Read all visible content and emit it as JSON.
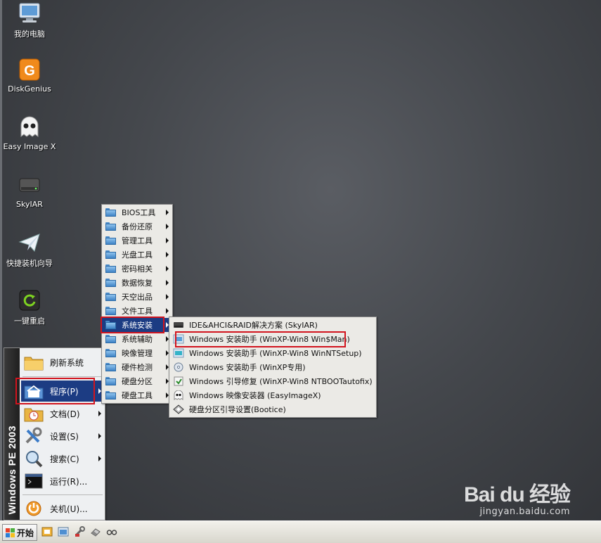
{
  "desktop": {
    "icons": [
      {
        "label": "我的电脑",
        "icon": "computer-icon"
      },
      {
        "label": "DiskGenius",
        "icon": "diskgenius-icon"
      },
      {
        "label": "Easy Image X",
        "icon": "ghost-icon"
      },
      {
        "label": "SkyIAR",
        "icon": "drive-icon"
      },
      {
        "label": "快捷装机向导",
        "icon": "paper-plane-icon"
      },
      {
        "label": "一键重启",
        "icon": "restart-icon"
      }
    ]
  },
  "start_menu": {
    "band_text": "Windows PE 2003",
    "items": [
      {
        "label": "刷新系统",
        "icon": "folder-icon",
        "has_submenu": false
      },
      {
        "label": "程序(P)",
        "icon": "programs-icon",
        "has_submenu": true,
        "active": true
      },
      {
        "label": "文档(D)",
        "icon": "documents-icon",
        "has_submenu": true
      },
      {
        "label": "设置(S)",
        "icon": "settings-icon",
        "has_submenu": true
      },
      {
        "label": "搜索(C)",
        "icon": "search-icon",
        "has_submenu": true
      },
      {
        "label": "运行(R)...",
        "icon": "run-icon",
        "has_submenu": false
      },
      {
        "label": "关机(U)...",
        "icon": "shutdown-icon",
        "has_submenu": false
      }
    ]
  },
  "programs_menu": {
    "items": [
      {
        "label": "BIOS工具"
      },
      {
        "label": "备份还原"
      },
      {
        "label": "管理工具"
      },
      {
        "label": "光盘工具"
      },
      {
        "label": "密码相关"
      },
      {
        "label": "数据恢复"
      },
      {
        "label": "天空出品"
      },
      {
        "label": "文件工具"
      },
      {
        "label": "系统安装",
        "active": true
      },
      {
        "label": "系统辅助"
      },
      {
        "label": "映像管理"
      },
      {
        "label": "硬件检测"
      },
      {
        "label": "硬盘分区"
      },
      {
        "label": "硬盘工具"
      }
    ]
  },
  "system_install_menu": {
    "items": [
      {
        "label": "IDE&AHCI&RAID解决方案 (SkyIAR)",
        "icon": "drive-icon"
      },
      {
        "label": "Windows 安装助手 (WinXP-Win8 Win$Man)",
        "icon": "installer-icon",
        "highlighted": true
      },
      {
        "label": "Windows 安装助手 (WinXP-Win8 WinNTSetup)",
        "icon": "installer-icon"
      },
      {
        "label": "Windows 安装助手 (WinXP专用)",
        "icon": "cd-installer-icon"
      },
      {
        "label": "Windows 引导修复 (WinXP-Win8 NTBOOTautofix)",
        "icon": "boot-fix-icon"
      },
      {
        "label": "Windows 映像安装器 (EasyImageX)",
        "icon": "ghost-icon"
      },
      {
        "label": "硬盘分区引导设置(Bootice)",
        "icon": "bootice-icon"
      }
    ]
  },
  "taskbar": {
    "start_label": "开始",
    "quick_launch": [
      "folder-icon",
      "explorer-icon",
      "tools-icon",
      "eraser-icon",
      "glasses-icon"
    ]
  },
  "watermark": {
    "logo": "Bai du 经验",
    "url": "jingyan.baidu.com"
  },
  "colors": {
    "menu_highlight": "#1c3c83",
    "annotation_box": "#d2141e",
    "menu_background": "#ebeae6"
  }
}
